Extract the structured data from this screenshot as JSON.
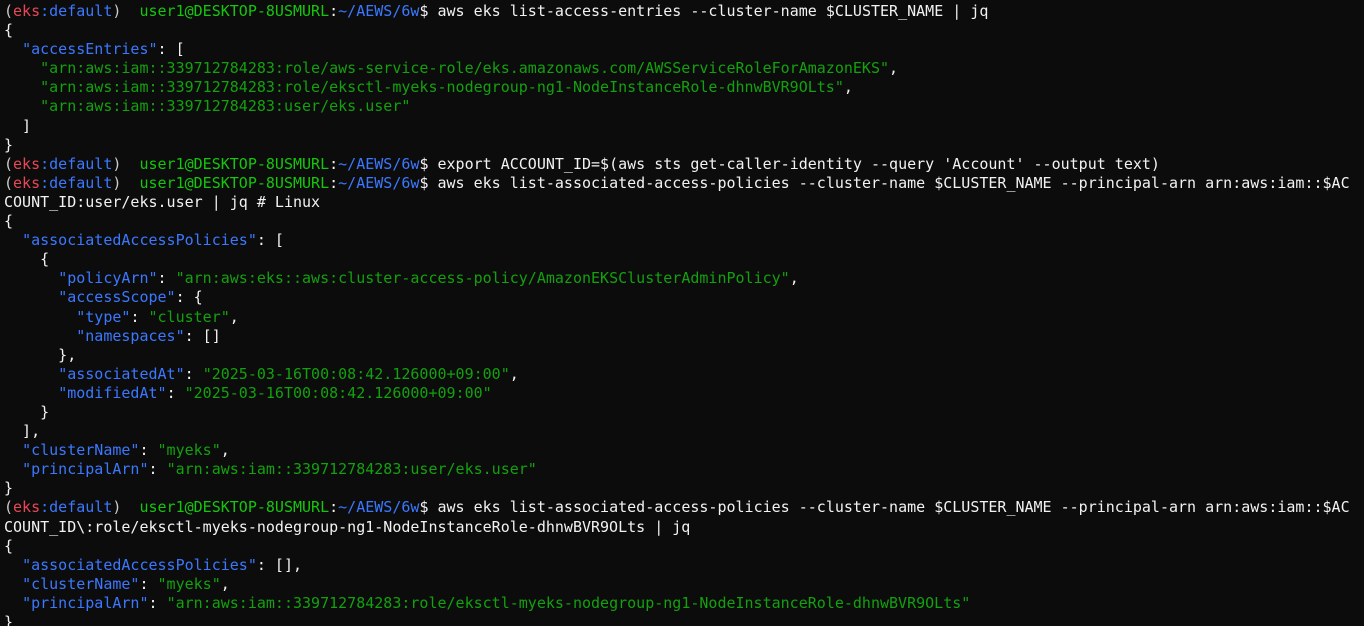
{
  "colors": {
    "background": "#0c0c0c",
    "foreground": "#cccccc",
    "prompt_env": "#e74856",
    "prompt_env_name": "#3b78ff",
    "prompt_user": "#16c60c",
    "prompt_path": "#3b78ff",
    "json_key": "#3b78ff",
    "json_string": "#13a10e"
  },
  "prompt": {
    "env": "eks",
    "env_suffix": ":default",
    "user_host": "user1@DESKTOP-8USMURL",
    "path": "~/AEWS/6w"
  },
  "lines": [
    {
      "type": "prompt",
      "command": "aws eks list-access-entries --cluster-name $CLUSTER_NAME | jq"
    },
    {
      "type": "json",
      "segments": [
        {
          "c": "text",
          "t": "{"
        }
      ]
    },
    {
      "type": "json",
      "segments": [
        {
          "c": "text",
          "t": "  "
        },
        {
          "c": "key",
          "t": "\"accessEntries\""
        },
        {
          "c": "text",
          "t": ": ["
        }
      ]
    },
    {
      "type": "json",
      "segments": [
        {
          "c": "text",
          "t": "    "
        },
        {
          "c": "str",
          "t": "\"arn:aws:iam::339712784283:role/aws-service-role/eks.amazonaws.com/AWSServiceRoleForAmazonEKS\""
        },
        {
          "c": "text",
          "t": ","
        }
      ]
    },
    {
      "type": "json",
      "segments": [
        {
          "c": "text",
          "t": "    "
        },
        {
          "c": "str",
          "t": "\"arn:aws:iam::339712784283:role/eksctl-myeks-nodegroup-ng1-NodeInstanceRole-dhnwBVR9OLts\""
        },
        {
          "c": "text",
          "t": ","
        }
      ]
    },
    {
      "type": "json",
      "segments": [
        {
          "c": "text",
          "t": "    "
        },
        {
          "c": "str",
          "t": "\"arn:aws:iam::339712784283:user/eks.user\""
        }
      ]
    },
    {
      "type": "json",
      "segments": [
        {
          "c": "text",
          "t": "  ]"
        }
      ]
    },
    {
      "type": "json",
      "segments": [
        {
          "c": "text",
          "t": "}"
        }
      ]
    },
    {
      "type": "prompt",
      "command": "export ACCOUNT_ID=$(aws sts get-caller-identity --query 'Account' --output text)"
    },
    {
      "type": "prompt",
      "command": "aws eks list-associated-access-policies --cluster-name $CLUSTER_NAME --principal-arn arn:aws:iam::$AC"
    },
    {
      "type": "json",
      "segments": [
        {
          "c": "text",
          "t": "COUNT_ID:user/eks.user | jq # Linux"
        }
      ]
    },
    {
      "type": "json",
      "segments": [
        {
          "c": "text",
          "t": "{"
        }
      ]
    },
    {
      "type": "json",
      "segments": [
        {
          "c": "text",
          "t": "  "
        },
        {
          "c": "key",
          "t": "\"associatedAccessPolicies\""
        },
        {
          "c": "text",
          "t": ": ["
        }
      ]
    },
    {
      "type": "json",
      "segments": [
        {
          "c": "text",
          "t": "    {"
        }
      ]
    },
    {
      "type": "json",
      "segments": [
        {
          "c": "text",
          "t": "      "
        },
        {
          "c": "key",
          "t": "\"policyArn\""
        },
        {
          "c": "text",
          "t": ": "
        },
        {
          "c": "str",
          "t": "\"arn:aws:eks::aws:cluster-access-policy/AmazonEKSClusterAdminPolicy\""
        },
        {
          "c": "text",
          "t": ","
        }
      ]
    },
    {
      "type": "json",
      "segments": [
        {
          "c": "text",
          "t": "      "
        },
        {
          "c": "key",
          "t": "\"accessScope\""
        },
        {
          "c": "text",
          "t": ": {"
        }
      ]
    },
    {
      "type": "json",
      "segments": [
        {
          "c": "text",
          "t": "        "
        },
        {
          "c": "key",
          "t": "\"type\""
        },
        {
          "c": "text",
          "t": ": "
        },
        {
          "c": "str",
          "t": "\"cluster\""
        },
        {
          "c": "text",
          "t": ","
        }
      ]
    },
    {
      "type": "json",
      "segments": [
        {
          "c": "text",
          "t": "        "
        },
        {
          "c": "key",
          "t": "\"namespaces\""
        },
        {
          "c": "text",
          "t": ": []"
        }
      ]
    },
    {
      "type": "json",
      "segments": [
        {
          "c": "text",
          "t": "      },"
        }
      ]
    },
    {
      "type": "json",
      "segments": [
        {
          "c": "text",
          "t": "      "
        },
        {
          "c": "key",
          "t": "\"associatedAt\""
        },
        {
          "c": "text",
          "t": ": "
        },
        {
          "c": "str",
          "t": "\"2025-03-16T00:08:42.126000+09:00\""
        },
        {
          "c": "text",
          "t": ","
        }
      ]
    },
    {
      "type": "json",
      "segments": [
        {
          "c": "text",
          "t": "      "
        },
        {
          "c": "key",
          "t": "\"modifiedAt\""
        },
        {
          "c": "text",
          "t": ": "
        },
        {
          "c": "str",
          "t": "\"2025-03-16T00:08:42.126000+09:00\""
        }
      ]
    },
    {
      "type": "json",
      "segments": [
        {
          "c": "text",
          "t": "    }"
        }
      ]
    },
    {
      "type": "json",
      "segments": [
        {
          "c": "text",
          "t": "  ],"
        }
      ]
    },
    {
      "type": "json",
      "segments": [
        {
          "c": "text",
          "t": "  "
        },
        {
          "c": "key",
          "t": "\"clusterName\""
        },
        {
          "c": "text",
          "t": ": "
        },
        {
          "c": "str",
          "t": "\"myeks\""
        },
        {
          "c": "text",
          "t": ","
        }
      ]
    },
    {
      "type": "json",
      "segments": [
        {
          "c": "text",
          "t": "  "
        },
        {
          "c": "key",
          "t": "\"principalArn\""
        },
        {
          "c": "text",
          "t": ": "
        },
        {
          "c": "str",
          "t": "\"arn:aws:iam::339712784283:user/eks.user\""
        }
      ]
    },
    {
      "type": "json",
      "segments": [
        {
          "c": "text",
          "t": "}"
        }
      ]
    },
    {
      "type": "prompt",
      "command": "aws eks list-associated-access-policies --cluster-name $CLUSTER_NAME --principal-arn arn:aws:iam::$AC"
    },
    {
      "type": "json",
      "segments": [
        {
          "c": "text",
          "t": "COUNT_ID\\:role/eksctl-myeks-nodegroup-ng1-NodeInstanceRole-dhnwBVR9OLts | jq"
        }
      ]
    },
    {
      "type": "json",
      "segments": [
        {
          "c": "text",
          "t": "{"
        }
      ]
    },
    {
      "type": "json",
      "segments": [
        {
          "c": "text",
          "t": "  "
        },
        {
          "c": "key",
          "t": "\"associatedAccessPolicies\""
        },
        {
          "c": "text",
          "t": ": [],"
        }
      ]
    },
    {
      "type": "json",
      "segments": [
        {
          "c": "text",
          "t": "  "
        },
        {
          "c": "key",
          "t": "\"clusterName\""
        },
        {
          "c": "text",
          "t": ": "
        },
        {
          "c": "str",
          "t": "\"myeks\""
        },
        {
          "c": "text",
          "t": ","
        }
      ]
    },
    {
      "type": "json",
      "segments": [
        {
          "c": "text",
          "t": "  "
        },
        {
          "c": "key",
          "t": "\"principalArn\""
        },
        {
          "c": "text",
          "t": ": "
        },
        {
          "c": "str",
          "t": "\"arn:aws:iam::339712784283:role/eksctl-myeks-nodegroup-ng1-NodeInstanceRole-dhnwBVR9OLts\""
        }
      ]
    },
    {
      "type": "json",
      "segments": [
        {
          "c": "text",
          "t": "}"
        }
      ]
    }
  ]
}
